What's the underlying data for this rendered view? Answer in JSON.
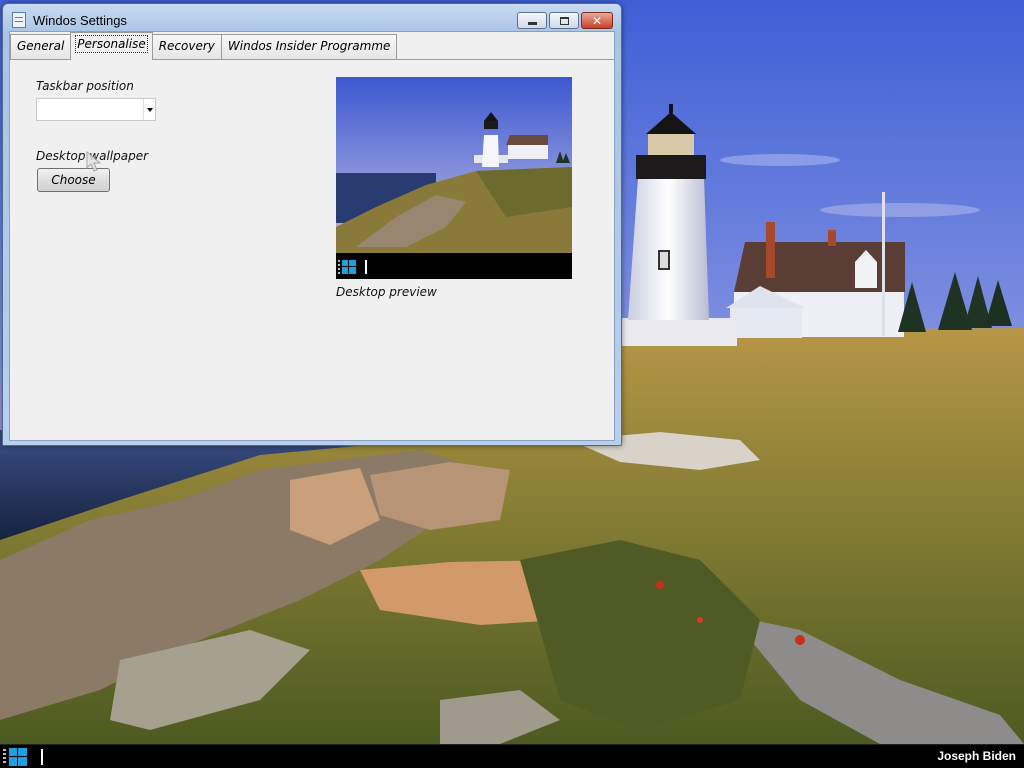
{
  "window": {
    "title": "Windos Settings",
    "tabs": [
      {
        "label": "General",
        "active": false
      },
      {
        "label": "Personalise",
        "active": true
      },
      {
        "label": "Recovery",
        "active": false
      },
      {
        "label": "Windos Insider Programme",
        "active": false
      }
    ],
    "personalise": {
      "taskbar_position_label": "Taskbar position",
      "taskbar_position_value": "",
      "desktop_wallpaper_label": "Desktop wallpaper",
      "choose_button": "Choose",
      "preview_caption": "Desktop preview"
    },
    "caption_buttons": [
      "minimize-icon",
      "maximize-icon",
      "close-icon"
    ]
  },
  "taskbar": {
    "user_name": "Joseph Biden",
    "start_icon": "windows-logo-icon"
  },
  "colors": {
    "accent_blue": "#1ba1e2",
    "close_red": "#c7412a",
    "taskbar": "#000000"
  }
}
